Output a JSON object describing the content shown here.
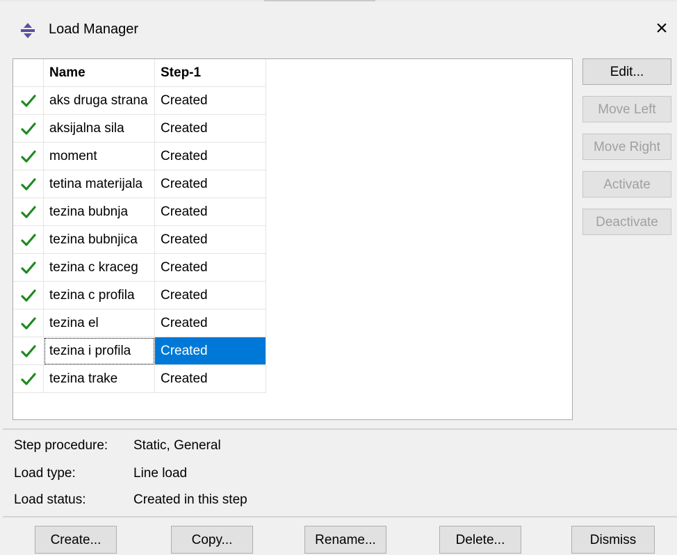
{
  "window": {
    "title": "Load Manager",
    "close_glyph": "×",
    "icon": "load-manager-icon"
  },
  "table": {
    "columns": [
      "",
      "Name",
      "Step-1"
    ],
    "rows": [
      {
        "active": true,
        "name": "aks druga strana",
        "step1": "Created"
      },
      {
        "active": true,
        "name": "aksijalna sila",
        "step1": "Created"
      },
      {
        "active": true,
        "name": "moment",
        "step1": "Created"
      },
      {
        "active": true,
        "name": "tetina materijala",
        "step1": "Created"
      },
      {
        "active": true,
        "name": "tezina bubnja",
        "step1": "Created"
      },
      {
        "active": true,
        "name": "tezina bubnjica",
        "step1": "Created"
      },
      {
        "active": true,
        "name": "tezina c kraceg",
        "step1": "Created"
      },
      {
        "active": true,
        "name": "tezina c profila",
        "step1": "Created"
      },
      {
        "active": true,
        "name": "tezina el",
        "step1": "Created"
      },
      {
        "active": true,
        "name": "tezina i profila",
        "step1": "Created",
        "selected": true
      },
      {
        "active": true,
        "name": "tezina trake",
        "step1": "Created"
      }
    ]
  },
  "side_buttons": [
    {
      "label": "Edit...",
      "enabled": true
    },
    {
      "label": "Move Left",
      "enabled": false
    },
    {
      "label": "Move Right",
      "enabled": false
    },
    {
      "label": "Activate",
      "enabled": false
    },
    {
      "label": "Deactivate",
      "enabled": false
    }
  ],
  "info": {
    "step_procedure_label": "Step procedure:",
    "step_procedure_value": "Static, General",
    "load_type_label": "Load type:",
    "load_type_value": "Line load",
    "load_status_label": "Load status:",
    "load_status_value": "Created in this step"
  },
  "bottom_buttons": {
    "create": "Create...",
    "copy": "Copy...",
    "rename": "Rename...",
    "delete": "Delete...",
    "dismiss": "Dismiss"
  },
  "colors": {
    "check": "#1f8a1f",
    "selection": "#0078d7",
    "disabled_text": "#a0a0a0"
  }
}
